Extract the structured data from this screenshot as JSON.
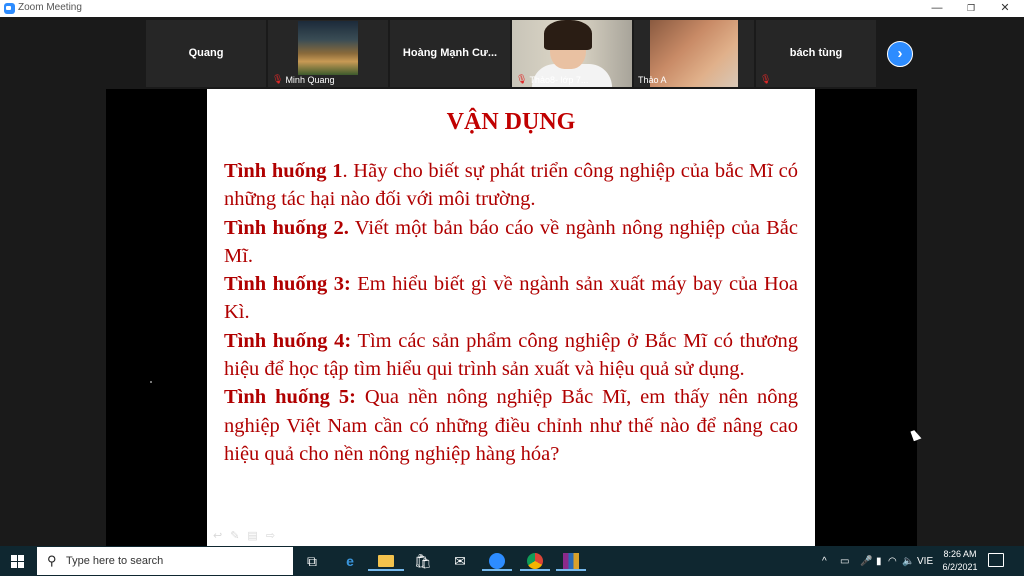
{
  "window": {
    "title": "Zoom Meeting",
    "min": "—",
    "max": "❐",
    "close": "✕"
  },
  "participants": [
    {
      "center_name": "Quang",
      "label": ""
    },
    {
      "center_name": "",
      "label": "Minh Quang"
    },
    {
      "center_name": "Hoàng Mạnh Cư...",
      "label": ""
    },
    {
      "center_name": "",
      "label": "Thảo8- lớp 7..."
    },
    {
      "center_name": "",
      "label": "Thảo A"
    },
    {
      "center_name": "bách tùng",
      "label": ""
    }
  ],
  "strip_next": "›",
  "slide": {
    "title": "VẬN DỤNG",
    "items": [
      {
        "label": "Tình huống 1",
        "text": ". Hãy cho biết sự phát triển công nghiệp của bắc Mĩ có những tác hại nào đối với môi trường."
      },
      {
        "label": "Tình huống 2.",
        "text": " Viết một bản báo cáo về ngành nông nghiệp của Bắc Mĩ."
      },
      {
        "label": "Tình huống 3:",
        "text": " Em hiểu biết gì về ngành sản xuất máy bay của Hoa Kì."
      },
      {
        "label": "Tình huống 4:",
        "text": " Tìm các sản phẩm công nghiệp ở Bắc Mĩ có thương hiệu để học tập tìm hiểu qui trình sản xuất và hiệu quả sử dụng."
      },
      {
        "label": "Tình huống 5:",
        "text": " Qua nền nông nghiệp Bắc Mĩ, em thấy nên nông nghiệp Việt Nam cần có những điều chỉnh như thế nào để nâng cao hiệu quả cho nền nông nghiệp hàng hóa?"
      }
    ]
  },
  "taskbar": {
    "search_placeholder": "Type here to search",
    "language": "VIE",
    "time": "8:26 AM",
    "date": "6/2/2021"
  }
}
